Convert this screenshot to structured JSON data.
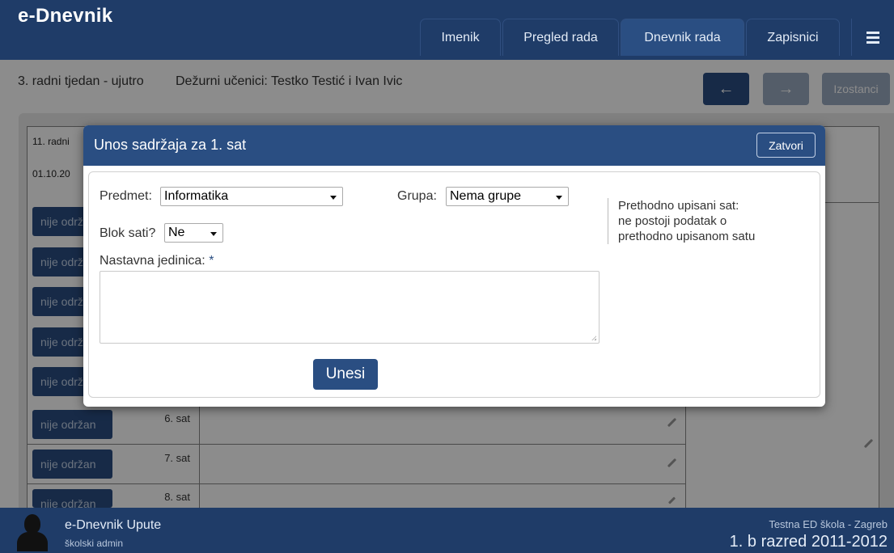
{
  "app": {
    "brand": "e-Dnevnik"
  },
  "nav": {
    "items": [
      {
        "label": "Imenik"
      },
      {
        "label": "Pregled rada"
      },
      {
        "label": "Dnevnik rada",
        "active": true
      },
      {
        "label": "Zapisnici"
      }
    ],
    "menu_icon": "hamburger-icon"
  },
  "info": {
    "week": "3. radni tjedan - ujutro",
    "duty": "Dežurni učenici: Testko Testić i Ivan Ivic"
  },
  "toolbar": {
    "prev_icon": "arrow-left-icon",
    "next_icon": "arrow-right-icon",
    "absences_label": "Izostanci"
  },
  "table": {
    "header_line1": "11. radni",
    "header_line2": "01.10.20",
    "rows": [
      {
        "status": "nije održan",
        "period": ""
      },
      {
        "status": "nije održan",
        "period": ""
      },
      {
        "status": "nije održan",
        "period": ""
      },
      {
        "status": "nije održan",
        "period": ""
      },
      {
        "status": "nije održan",
        "period": ""
      },
      {
        "status": "nije održan",
        "period": "6. sat"
      },
      {
        "status": "nije održan",
        "period": "7. sat"
      },
      {
        "status": "nije održan",
        "period": "8. sat"
      }
    ]
  },
  "modal": {
    "title": "Unos sadržaja za 1. sat",
    "close_label": "Zatvori",
    "subject_label": "Predmet:",
    "subject_value": "Informatika",
    "group_label": "Grupa:",
    "group_value": "Nema grupe",
    "block_label": "Blok sati?",
    "block_value": "Ne",
    "unit_label": "Nastavna jedinica:",
    "unit_required": "*",
    "unit_value": "",
    "submit_label": "Unesi",
    "prev_title": "Prethodno upisani sat:",
    "prev_text": "ne postoji podatak o prethodno upisanom satu"
  },
  "footer": {
    "user": "e-Dnevnik Upute",
    "role": "školski admin",
    "school": "Testna ED škola - Zagreb",
    "class_year": "1. b razred 2011-2012"
  },
  "colors": {
    "navy": "#1f3c68",
    "button_blue": "#2a4e82",
    "disabled": "#9aa9bf"
  }
}
